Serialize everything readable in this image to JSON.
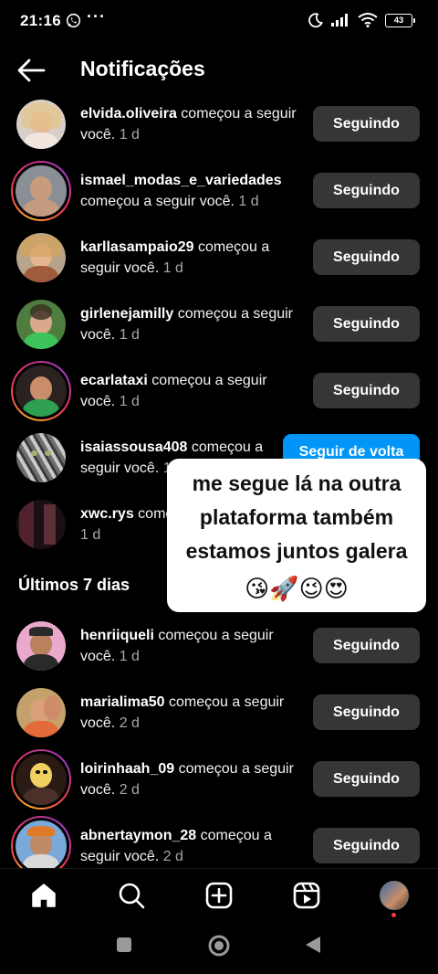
{
  "status_bar": {
    "time": "21:16",
    "dots": "···",
    "battery": "43"
  },
  "header": {
    "title": "Notificações"
  },
  "rows_today": [
    {
      "username": "elvida.oliveira",
      "action": " começou a seguir você.",
      "time": " 1 d",
      "button": "Seguindo"
    },
    {
      "username": "ismael_modas_e_variedades",
      "action": " começou a seguir você.",
      "time": " 1 d",
      "button": "Seguindo"
    },
    {
      "username": "karllasampaio29",
      "action": " começou a seguir você.",
      "time": " 1 d",
      "button": "Seguindo"
    },
    {
      "username": "girlenejamilly",
      "action": " começou a seguir você.",
      "time": " 1 d",
      "button": "Seguindo"
    },
    {
      "username": "ecarlataxi",
      "action": " começou a seguir você.",
      "time": " 1 d",
      "button": "Seguindo"
    },
    {
      "username": "isaiassousa408",
      "action": " começou a seguir você.",
      "time": " 1 d",
      "button": "Seguir de volta"
    },
    {
      "username": "xwc.rys",
      "action": " começou a seguir você.",
      "time": " 1 d",
      "button": ""
    }
  ],
  "section_last7": "Últimos 7 dias",
  "rows_week": [
    {
      "username": "henriiqueli",
      "action": " começou a seguir você.",
      "time": " 1 d",
      "button": "Seguindo"
    },
    {
      "username": "marialima50",
      "action": " começou a seguir você.",
      "time": " 2 d",
      "button": "Seguindo"
    },
    {
      "username": "loirinhaah_09",
      "action": " começou a seguir você.",
      "time": " 2 d",
      "button": "Seguindo"
    },
    {
      "username": "abnertaymon_28",
      "action": " começou a seguir você.",
      "time": " 2 d",
      "button": "Seguindo"
    }
  ],
  "overlay": {
    "line1": "me segue lá na outra",
    "line2": "plataforma também",
    "line3": "estamos juntos galera",
    "emojis": "😘🚀😉😍"
  },
  "icons": {
    "back": "arrow-left-icon",
    "home": "home-icon",
    "search": "search-icon",
    "create": "plus-square-icon",
    "reels": "reels-icon"
  },
  "colors": {
    "follow_blue": "#0095f6",
    "following_gray": "#363636"
  }
}
